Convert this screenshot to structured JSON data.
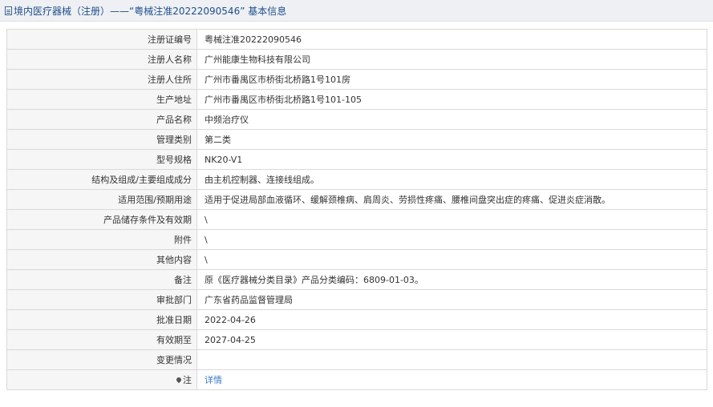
{
  "header": {
    "title": "境内医疗器械（注册）——“粤械注准20222090546” 基本信息"
  },
  "rows": [
    {
      "label": "注册证编号",
      "value": "粤械注准20222090546"
    },
    {
      "label": "注册人名称",
      "value": "广州能康生物科技有限公司"
    },
    {
      "label": "注册人住所",
      "value": "广州市番禺区市桥街北桥路1号101房"
    },
    {
      "label": "生产地址",
      "value": "广州市番禺区市桥街北桥路1号101-105"
    },
    {
      "label": "产品名称",
      "value": "中频治疗仪"
    },
    {
      "label": "管理类别",
      "value": "第二类"
    },
    {
      "label": "型号规格",
      "value": "NK20-V1"
    },
    {
      "label": "结构及组成/主要组成成分",
      "value": "由主机控制器、连接线组成。"
    },
    {
      "label": "适用范围/预期用途",
      "value": "适用于促进局部血液循环、缓解颈椎病、肩周炎、劳损性疼痛、腰椎间盘突出症的疼痛、促进炎症消散。"
    },
    {
      "label": "产品储存条件及有效期",
      "value": "\\"
    },
    {
      "label": "附件",
      "value": "\\"
    },
    {
      "label": "其他内容",
      "value": "\\"
    },
    {
      "label": "备注",
      "value": "原《医疗器械分类目录》产品分类编码：6809-01-03。"
    },
    {
      "label": "审批部门",
      "value": "广东省药品监督管理局"
    },
    {
      "label": "批准日期",
      "value": "2022-04-26"
    },
    {
      "label": "有效期至",
      "value": "2027-04-25"
    },
    {
      "label": "变更情况",
      "value": ""
    }
  ],
  "note": {
    "label": "注",
    "link_text": "详情",
    "icon": "pin-icon"
  },
  "colors": {
    "link": "#3d7cc9",
    "header_title": "#1f4e8c",
    "label_bg": "#f6f6f6",
    "border": "#d9d9d9"
  }
}
